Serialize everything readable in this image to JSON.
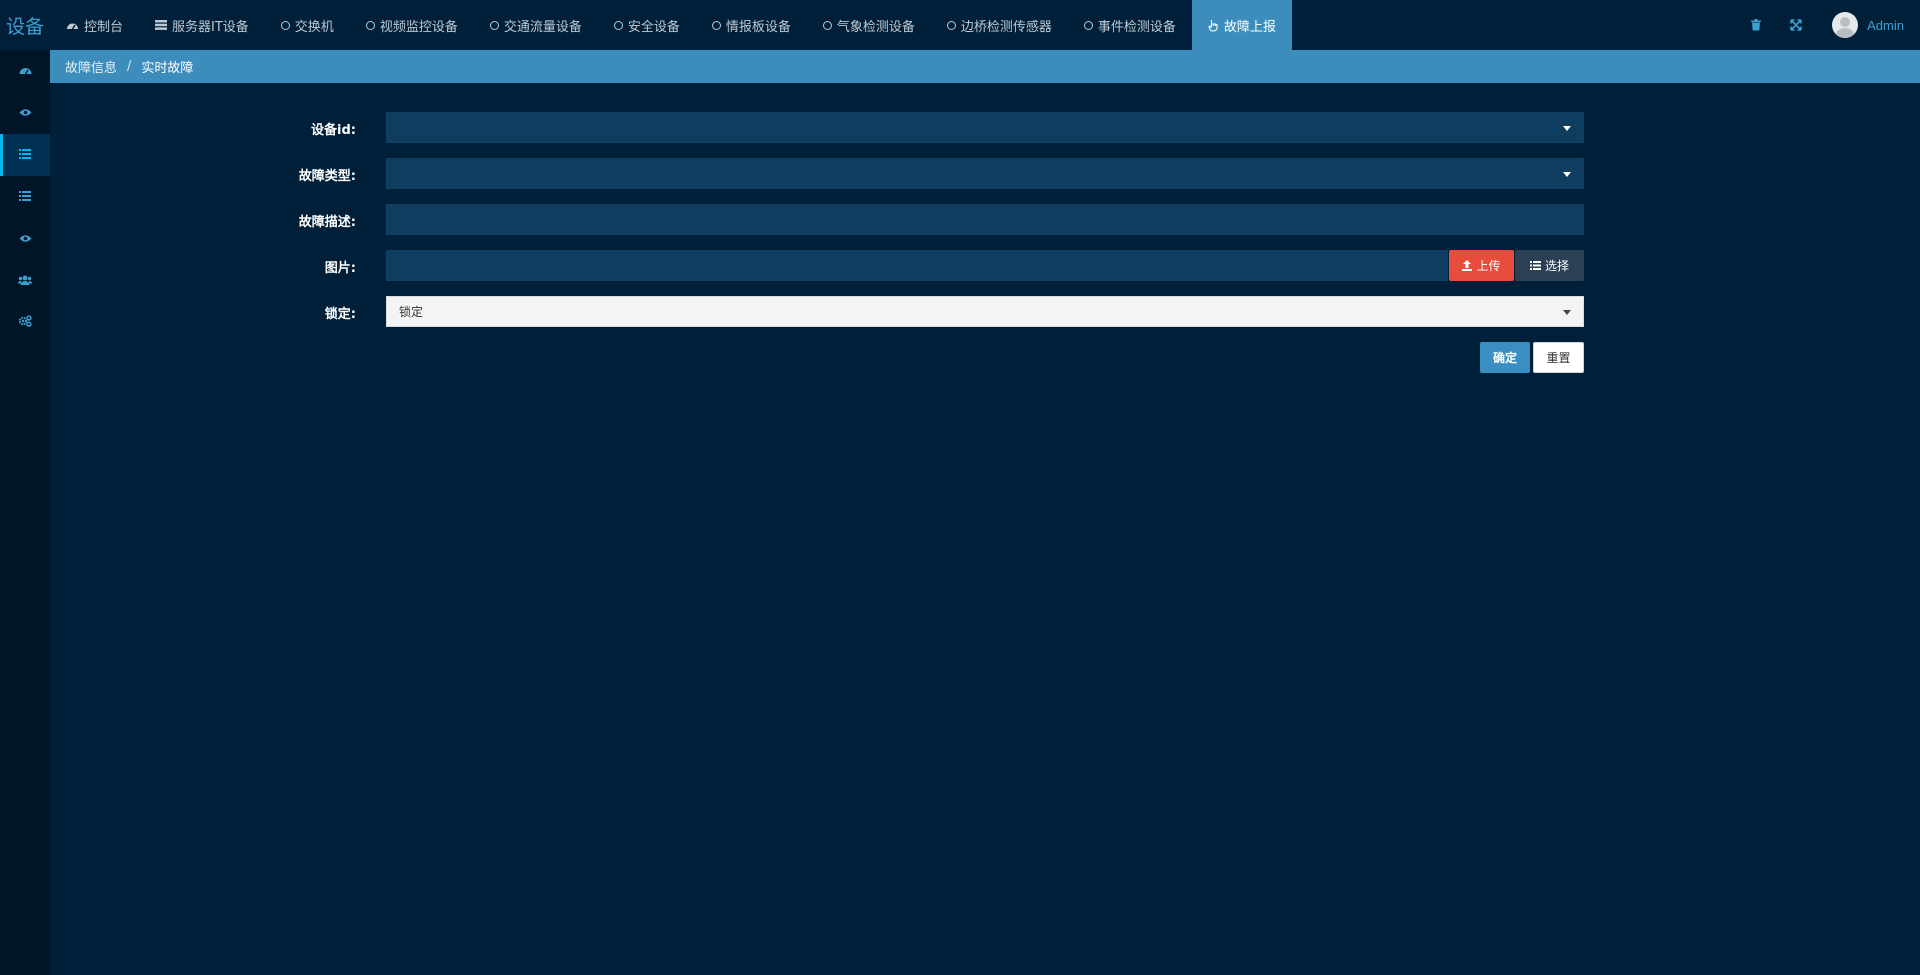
{
  "app": {
    "logo_text": "设备"
  },
  "nav": {
    "items": [
      {
        "label": "控制台",
        "icon": "dashboard-icon"
      },
      {
        "label": "服务器IT设备",
        "icon": "server-icon"
      },
      {
        "label": "交换机",
        "icon": "circle-icon"
      },
      {
        "label": "视频监控设备",
        "icon": "circle-icon"
      },
      {
        "label": "交通流量设备",
        "icon": "circle-icon"
      },
      {
        "label": "安全设备",
        "icon": "circle-icon"
      },
      {
        "label": "情报板设备",
        "icon": "circle-icon"
      },
      {
        "label": "气象检测设备",
        "icon": "circle-icon"
      },
      {
        "label": "边桥检测传感器",
        "icon": "circle-icon"
      },
      {
        "label": "事件检测设备",
        "icon": "circle-icon"
      },
      {
        "label": "故障上报",
        "icon": "hand-pointer-icon",
        "active": true
      }
    ]
  },
  "topbar_right": {
    "icons": [
      "trash-icon",
      "fullscreen-icon"
    ],
    "user_name": "Admin"
  },
  "sidebar": {
    "icons": [
      "dashboard-icon",
      "eye-icon",
      "list-icon",
      "list-icon",
      "eye-icon",
      "users-icon",
      "cogs-icon"
    ],
    "active_index": 2
  },
  "breadcrumb": {
    "items": [
      "故障信息",
      "实时故障"
    ],
    "separator": "/"
  },
  "form": {
    "device_id_label": "设备id:",
    "fault_type_label": "故障类型:",
    "fault_desc_label": "故障描述:",
    "image_label": "图片:",
    "lock_label": "锁定:",
    "lock_value": "锁定",
    "upload_label": "上传",
    "choose_label": "选择",
    "submit_label": "确定",
    "reset_label": "重置"
  },
  "colors": {
    "background": "#002039",
    "sidebar": "#001528",
    "accent": "#3c8dbc",
    "field": "#0e3d5f",
    "danger": "#e74c3c"
  }
}
